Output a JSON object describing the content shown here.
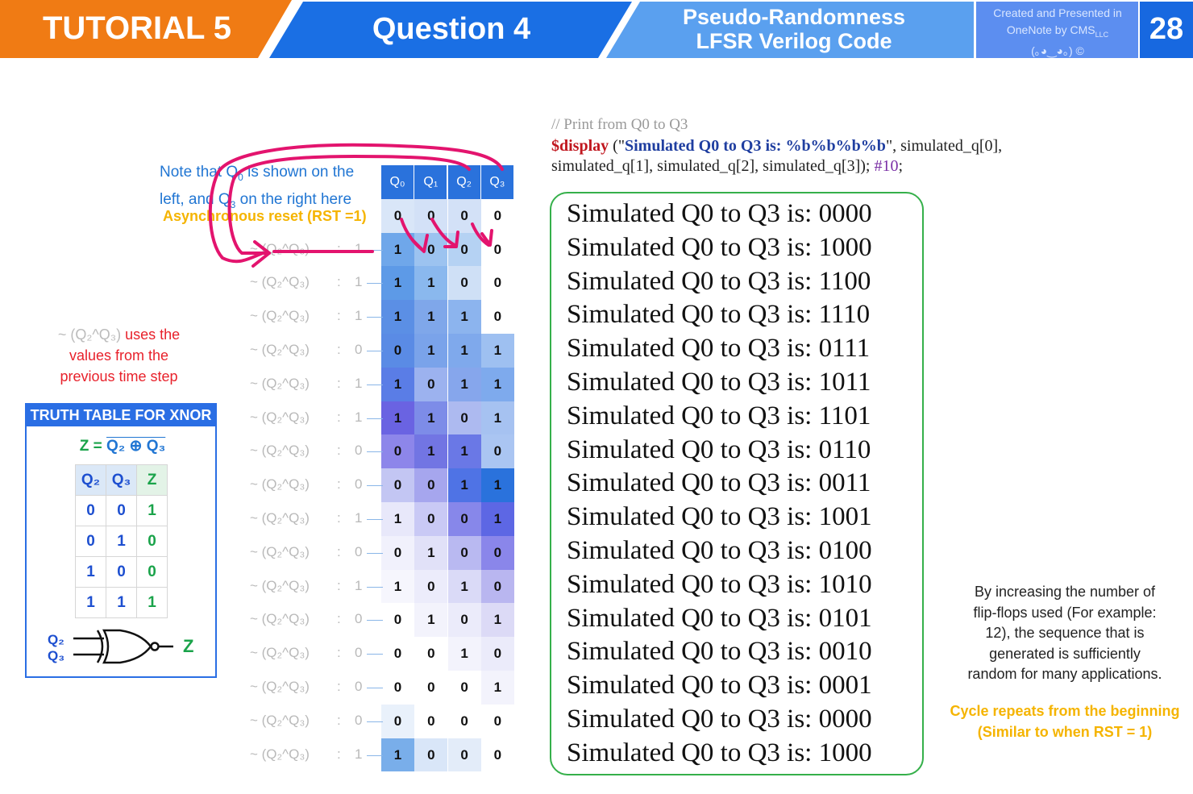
{
  "header": {
    "tutorial": "TUTORIAL 5",
    "question": "Question 4",
    "topic_line1": "Pseudo-Randomness",
    "topic_line2": "LFSR Verilog Code",
    "credit_line1": "Created and Presented in",
    "credit_line2": "OneNote by CMS",
    "credit_sub": "LLC",
    "credit_line3": "(｡◕‿◕｡) ©",
    "page_number": "28",
    "colors": {
      "orange": "#f07b14",
      "blue": "#1a6fe4",
      "light_blue": "#5aa0ef",
      "credit_blue": "#5c8ef0",
      "page_blue": "#1768e0"
    }
  },
  "annotations": {
    "note_1": "Note that Q",
    "note_sub0": "0",
    "note_2": " is shown on the",
    "note_3": "left, and Q",
    "note_sub3": "3",
    "note_4": " on the right here",
    "async_reset": "Asynchronous reset (RST =1)",
    "xnor_expr": "~ (Q₂^Q₃)",
    "xnor_note_1": " uses the",
    "xnor_note_2": "values from the",
    "xnor_note_3": "previous time step"
  },
  "truth_table": {
    "title": "TRUTH TABLE FOR XNOR",
    "eq_lhs": "Z = ",
    "eq_rhs": "Q₂ ⊕ Q₃",
    "headers": [
      "Q₂",
      "Q₃",
      "Z"
    ],
    "rows": [
      [
        "0",
        "0",
        "1"
      ],
      [
        "0",
        "1",
        "0"
      ],
      [
        "1",
        "0",
        "0"
      ],
      [
        "1",
        "1",
        "1"
      ]
    ],
    "gate_in1": "Q₂",
    "gate_in2": "Q₃",
    "gate_out": "Z"
  },
  "lfsr": {
    "headers": [
      "Q₀",
      "Q₁",
      "Q₂",
      "Q₃"
    ],
    "feedback_expr": "~ (Q₂^Q₃)",
    "feedback_sep": ":",
    "feedback_values": [
      "",
      "1",
      "1",
      "1",
      "0",
      "1",
      "1",
      "0",
      "0",
      "1",
      "0",
      "1",
      "0",
      "0",
      "0",
      "0",
      "1"
    ],
    "states": [
      [
        "0",
        "0",
        "0",
        "0"
      ],
      [
        "1",
        "0",
        "0",
        "0"
      ],
      [
        "1",
        "1",
        "0",
        "0"
      ],
      [
        "1",
        "1",
        "1",
        "0"
      ],
      [
        "0",
        "1",
        "1",
        "1"
      ],
      [
        "1",
        "0",
        "1",
        "1"
      ],
      [
        "1",
        "1",
        "0",
        "1"
      ],
      [
        "0",
        "1",
        "1",
        "0"
      ],
      [
        "0",
        "0",
        "1",
        "1"
      ],
      [
        "1",
        "0",
        "0",
        "1"
      ],
      [
        "0",
        "1",
        "0",
        "0"
      ],
      [
        "1",
        "0",
        "1",
        "0"
      ],
      [
        "0",
        "1",
        "0",
        "1"
      ],
      [
        "0",
        "0",
        "1",
        "0"
      ],
      [
        "0",
        "0",
        "0",
        "1"
      ],
      [
        "0",
        "0",
        "0",
        "0"
      ],
      [
        "1",
        "0",
        "0",
        "0"
      ]
    ]
  },
  "code": {
    "comment": "// Print from Q0 to Q3",
    "keyword": "$display",
    "open": " (\"",
    "string": "Simulated Q0 to Q3 is: %b%b%b%b",
    "args_1": "\", simulated_q[0],",
    "args_2": "simulated_q[1], simulated_q[2], simulated_q[3]); ",
    "delay": "#10",
    "end": ";"
  },
  "output_lines": [
    "Simulated Q0 to Q3 is: 0000",
    "Simulated Q0 to Q3 is: 1000",
    "Simulated Q0 to Q3 is: 1100",
    "Simulated Q0 to Q3 is: 1110",
    "Simulated Q0 to Q3 is: 0111",
    "Simulated Q0 to Q3 is: 1011",
    "Simulated Q0 to Q3 is: 1101",
    "Simulated Q0 to Q3 is: 0110",
    "Simulated Q0 to Q3 is: 0011",
    "Simulated Q0 to Q3 is: 1001",
    "Simulated Q0 to Q3 is: 0100",
    "Simulated Q0 to Q3 is: 1010",
    "Simulated Q0 to Q3 is: 0101",
    "Simulated Q0 to Q3 is: 0010",
    "Simulated Q0 to Q3 is: 0001",
    "Simulated Q0 to Q3 is: 0000",
    "Simulated Q0 to Q3 is: 1000"
  ],
  "side_note": {
    "line1": "By increasing the number of",
    "line2": "flip-flops used (For example:",
    "line3": "12), the sequence that is",
    "line4": "generated is sufficiently",
    "line5": "random for many applications.",
    "cycle1": "Cycle repeats from the beginning",
    "cycle2": "(Similar to when RST = 1)"
  }
}
